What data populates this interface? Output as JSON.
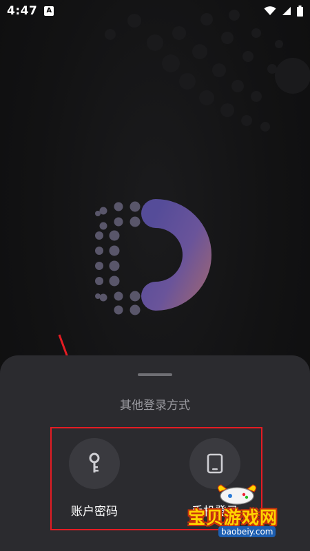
{
  "status_bar": {
    "time": "4:47",
    "notification_glyph": "A",
    "icons": [
      "wifi-icon",
      "signal-icon",
      "battery-icon"
    ]
  },
  "colors": {
    "background": "#121213",
    "sheet": "#2b2b2f",
    "option_circle": "#3a3a3f",
    "logo_arc_start": "#5a4e97",
    "logo_arc_end": "#8a5f86",
    "annotation_red": "#e51c23"
  },
  "login_sheet": {
    "title": "其他登录方式",
    "options": [
      {
        "label": "账户密码",
        "icon": "key-icon"
      },
      {
        "label": "手机登录",
        "icon": "phone-icon"
      }
    ]
  },
  "watermark": {
    "text": "宝贝游戏网",
    "url": "baobeiy.com"
  }
}
